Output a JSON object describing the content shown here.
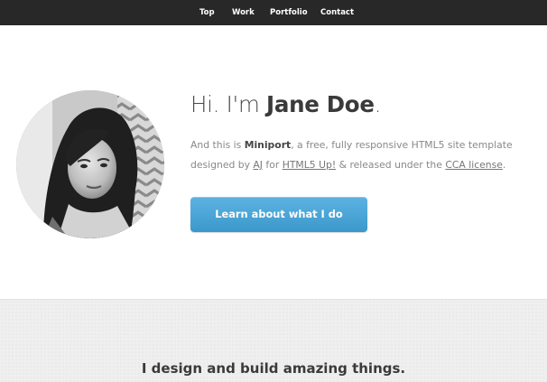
{
  "nav": {
    "items": [
      {
        "label": "Top"
      },
      {
        "label": "Work"
      },
      {
        "label": "Portfolio"
      },
      {
        "label": "Contact"
      }
    ]
  },
  "hero": {
    "greeting_prefix": "Hi. I'm ",
    "name": "Jane Doe",
    "greeting_suffix": ".",
    "intro": {
      "p1": "And this is ",
      "brand": "Miniport",
      "p2": ", a free, fully responsive HTML5 site template",
      "p3": "designed by ",
      "author": "AJ",
      "p4": " for ",
      "site": "HTML5 Up!",
      "p5": " & released under the ",
      "license": "CCA license",
      "p6": "."
    },
    "cta_label": "Learn about what I do"
  },
  "work": {
    "title": "I design and build amazing things."
  },
  "colors": {
    "navbar": "#282828",
    "button_top": "#5cb3e2",
    "button_bottom": "#3c98cb",
    "section_bg": "#efefef"
  }
}
